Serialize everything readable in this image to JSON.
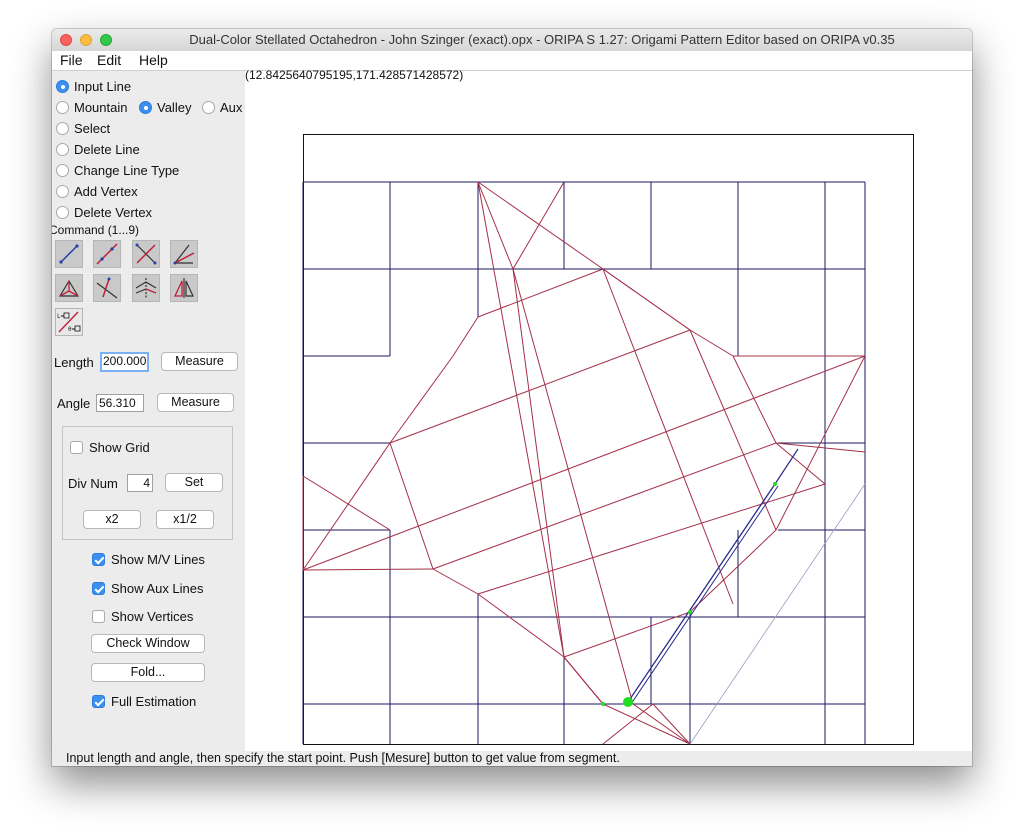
{
  "window": {
    "title": "Dual-Color Stellated Octahedron - John Szinger (exact).opx - ORIPA S 1.27: Origami Pattern Editor based on ORIPA  v0.35"
  },
  "menu": [
    "File",
    "Edit",
    "Help"
  ],
  "modes": {
    "input_line": "Input Line",
    "mountain": "Mountain",
    "valley": "Valley",
    "aux": "Aux",
    "select": "Select",
    "delete_line": "Delete Line",
    "change_line_type": "Change Line Type",
    "add_vertex": "Add Vertex",
    "delete_vertex": "Delete Vertex",
    "selected_mode": "Input Line",
    "selected_line_type": "Valley"
  },
  "command": {
    "label": "Command (1...9)",
    "tools": [
      "line-by-two-points-icon",
      "line-segment-icon",
      "perpendicular-bisector-icon",
      "angle-bisector-icon",
      "triangle-incenter-icon",
      "perpendicular-line-icon",
      "mirror-symmetry-icon",
      "mirror-copy-icon",
      "length-angle-line-icon"
    ]
  },
  "length": {
    "label": "Length",
    "value": "200.000",
    "measure_label": "Measure"
  },
  "angle": {
    "label": "Angle",
    "value": "56.310",
    "measure_label": "Measure"
  },
  "grid": {
    "show_grid_label": "Show Grid",
    "show_grid": false,
    "div_num_label": "Div Num",
    "div_num_value": "4",
    "set_label": "Set",
    "x2_label": "x2",
    "half_label": "x1/2"
  },
  "display": {
    "show_mv_label": "Show M/V Lines",
    "show_mv": true,
    "show_aux_label": "Show Aux Lines",
    "show_aux": true,
    "show_vertices_label": "Show Vertices",
    "show_vertices": false,
    "check_window_label": "Check Window",
    "fold_label": "Fold...",
    "full_estimation_label": "Full Estimation",
    "full_estimation": true
  },
  "canvas": {
    "coordinate_readout": "(12.8425640795195,171.428571428572)",
    "colors": {
      "mountain": "#1c1a5e",
      "valley": "#a4304a",
      "aux": "#9a9ac8",
      "selected": "#2b2a8c",
      "vertex": "#22dd22"
    }
  },
  "status": "Input length and angle, then specify the start point. Push [Mesure] button to get value from segment."
}
